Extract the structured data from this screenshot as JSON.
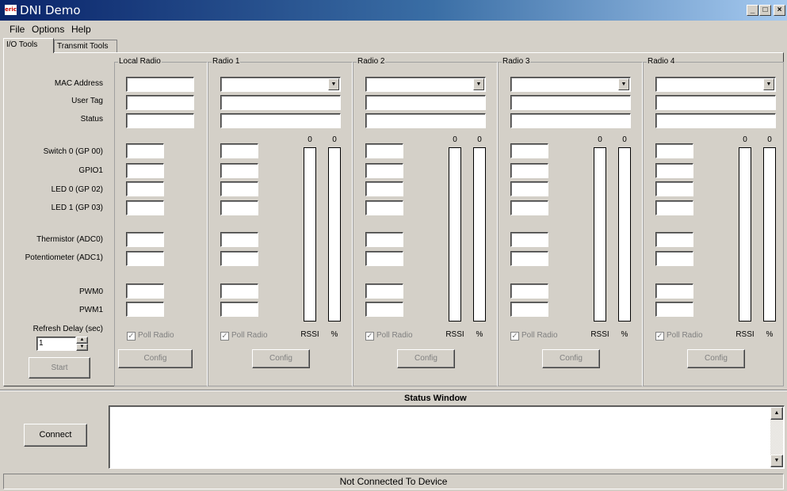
{
  "window": {
    "app_icon_text": "eric",
    "title": "DNI Demo"
  },
  "title_buttons": {
    "minimize": "_",
    "maximize": "□",
    "close": "×"
  },
  "menu": [
    "File",
    "Options",
    "Help"
  ],
  "tabs": [
    {
      "label": "I/O Tools",
      "active": true
    },
    {
      "label": "Transmit Tools",
      "active": false
    }
  ],
  "local_radio": {
    "title": "Local Radio",
    "labels": {
      "mac": "MAC Address",
      "usertag": "User Tag",
      "status": "Status",
      "switch0": "Switch 0 (GP 00)",
      "gpio1": "GPIO1",
      "led0": "LED 0 (GP 02)",
      "led1": "LED 1 (GP 03)",
      "thermistor": "Thermistor (ADC0)",
      "potentiometer": "Potentiometer (ADC1)",
      "pwm0": "PWM0",
      "pwm1": "PWM1",
      "refresh": "Refresh Delay (sec)"
    },
    "refresh_value": "1",
    "poll_label": "Poll Radio",
    "config_label": "Config",
    "start_label": "Start"
  },
  "remote_radios": [
    {
      "title": "Radio 1",
      "rssi_value": "0",
      "pct_value": "0",
      "rssi_label": "RSSI",
      "pct_label": "%",
      "poll_label": "Poll Radio",
      "config_label": "Config"
    },
    {
      "title": "Radio 2",
      "rssi_value": "0",
      "pct_value": "0",
      "rssi_label": "RSSI",
      "pct_label": "%",
      "poll_label": "Poll Radio",
      "config_label": "Config"
    },
    {
      "title": "Radio 3",
      "rssi_value": "0",
      "pct_value": "0",
      "rssi_label": "RSSI",
      "pct_label": "%",
      "poll_label": "Poll Radio",
      "config_label": "Config"
    },
    {
      "title": "Radio 4",
      "rssi_value": "0",
      "pct_value": "0",
      "rssi_label": "RSSI",
      "pct_label": "%",
      "poll_label": "Poll Radio",
      "config_label": "Config"
    }
  ],
  "status_window": {
    "title": "Status Window",
    "connect_label": "Connect",
    "text": ""
  },
  "statusbar": {
    "text": "Not Connected To Device"
  }
}
